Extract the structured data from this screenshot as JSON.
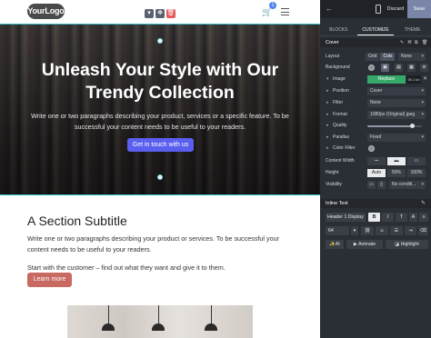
{
  "canvas": {
    "logo_text": "YourLogo",
    "cart_count": "1",
    "hero": {
      "title": "Unleash Your Style with Our Trendy Collection",
      "text": "Write one or two paragraphs describing your product, services or a specific feature. To be successful your content needs to be useful to your readers.",
      "button": "Get in touch with us"
    },
    "section": {
      "title": "A Section Subtitle",
      "text1": "Write one or two paragraphs describing your product or services. To be successful your content needs to be useful to your readers.",
      "text2": "Start with the customer – find out what they want and give it to them.",
      "button": "Learn more"
    }
  },
  "panel": {
    "discard": "Discard",
    "save": "Save",
    "tabs": [
      "BLOCKS",
      "CUSTOMIZE",
      "THEME"
    ],
    "active_tab": "CUSTOMIZE",
    "section_title": "Cover",
    "rows": {
      "layout": {
        "label": "Layout",
        "options": [
          "Grid",
          "Cols",
          "None"
        ]
      },
      "background": {
        "label": "Background"
      },
      "image": {
        "label": "Image",
        "replace": "Replace",
        "size": "95.1 kb"
      },
      "position": {
        "label": "Position",
        "value": "Cover"
      },
      "filter": {
        "label": "Filter",
        "value": "None"
      },
      "format": {
        "label": "Format",
        "value": "1080px (Original) jpeg"
      },
      "quality": {
        "label": "Quality",
        "level": 0.82
      },
      "parallax": {
        "label": "Parallax",
        "value": "Fixed"
      },
      "color_filter": {
        "label": "Color Filter"
      },
      "content_width": {
        "label": "Content Width"
      },
      "height": {
        "label": "Height",
        "options": [
          "Auto",
          "50%",
          "100%"
        ]
      },
      "visibility": {
        "label": "Visibility",
        "value": "No conditi..."
      }
    },
    "inline_text": {
      "title": "Inline Text",
      "font": "Header 1 Display",
      "size": "64",
      "ai": "AI",
      "animate": "Animate",
      "highlight": "Highlight"
    }
  },
  "colors": {
    "accent_blue": "#5b5ff0",
    "learn_more": "#c96a62",
    "replace_green": "#35a86a",
    "save_button": "#7a86a8",
    "selection_cyan": "#33c0c8"
  }
}
